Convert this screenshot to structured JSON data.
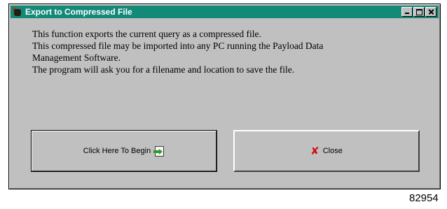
{
  "window": {
    "title": "Export to Compressed File",
    "icon": "app-icon",
    "title_bar_color": "#138a78"
  },
  "description": {
    "lines": [
      "This function exports the current query as a compressed file.",
      "This compressed file may be imported into any PC running the Payload Data",
      "Management Software.",
      "The program will ask you for a filename and location to save the file."
    ]
  },
  "buttons": {
    "begin_label": "Click Here To Begin",
    "begin_icon": "export-file-icon",
    "close_label": "Close",
    "close_icon": "red-x-icon"
  },
  "figure_number": "82954"
}
